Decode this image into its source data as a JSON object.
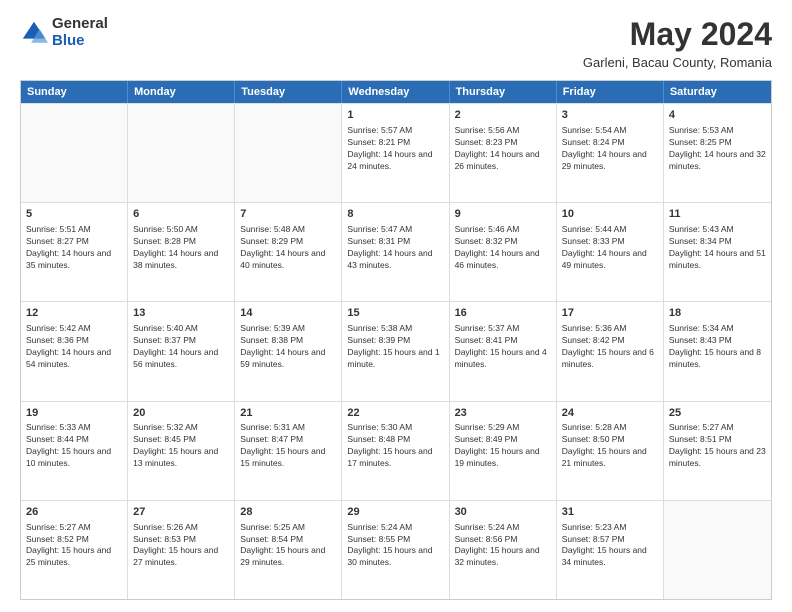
{
  "logo": {
    "general": "General",
    "blue": "Blue"
  },
  "title": "May 2024",
  "location": "Garleni, Bacau County, Romania",
  "header_days": [
    "Sunday",
    "Monday",
    "Tuesday",
    "Wednesday",
    "Thursday",
    "Friday",
    "Saturday"
  ],
  "weeks": [
    [
      {
        "day": "",
        "sunrise": "",
        "sunset": "",
        "daylight": ""
      },
      {
        "day": "",
        "sunrise": "",
        "sunset": "",
        "daylight": ""
      },
      {
        "day": "",
        "sunrise": "",
        "sunset": "",
        "daylight": ""
      },
      {
        "day": "1",
        "sunrise": "Sunrise: 5:57 AM",
        "sunset": "Sunset: 8:21 PM",
        "daylight": "Daylight: 14 hours and 24 minutes."
      },
      {
        "day": "2",
        "sunrise": "Sunrise: 5:56 AM",
        "sunset": "Sunset: 8:23 PM",
        "daylight": "Daylight: 14 hours and 26 minutes."
      },
      {
        "day": "3",
        "sunrise": "Sunrise: 5:54 AM",
        "sunset": "Sunset: 8:24 PM",
        "daylight": "Daylight: 14 hours and 29 minutes."
      },
      {
        "day": "4",
        "sunrise": "Sunrise: 5:53 AM",
        "sunset": "Sunset: 8:25 PM",
        "daylight": "Daylight: 14 hours and 32 minutes."
      }
    ],
    [
      {
        "day": "5",
        "sunrise": "Sunrise: 5:51 AM",
        "sunset": "Sunset: 8:27 PM",
        "daylight": "Daylight: 14 hours and 35 minutes."
      },
      {
        "day": "6",
        "sunrise": "Sunrise: 5:50 AM",
        "sunset": "Sunset: 8:28 PM",
        "daylight": "Daylight: 14 hours and 38 minutes."
      },
      {
        "day": "7",
        "sunrise": "Sunrise: 5:48 AM",
        "sunset": "Sunset: 8:29 PM",
        "daylight": "Daylight: 14 hours and 40 minutes."
      },
      {
        "day": "8",
        "sunrise": "Sunrise: 5:47 AM",
        "sunset": "Sunset: 8:31 PM",
        "daylight": "Daylight: 14 hours and 43 minutes."
      },
      {
        "day": "9",
        "sunrise": "Sunrise: 5:46 AM",
        "sunset": "Sunset: 8:32 PM",
        "daylight": "Daylight: 14 hours and 46 minutes."
      },
      {
        "day": "10",
        "sunrise": "Sunrise: 5:44 AM",
        "sunset": "Sunset: 8:33 PM",
        "daylight": "Daylight: 14 hours and 49 minutes."
      },
      {
        "day": "11",
        "sunrise": "Sunrise: 5:43 AM",
        "sunset": "Sunset: 8:34 PM",
        "daylight": "Daylight: 14 hours and 51 minutes."
      }
    ],
    [
      {
        "day": "12",
        "sunrise": "Sunrise: 5:42 AM",
        "sunset": "Sunset: 8:36 PM",
        "daylight": "Daylight: 14 hours and 54 minutes."
      },
      {
        "day": "13",
        "sunrise": "Sunrise: 5:40 AM",
        "sunset": "Sunset: 8:37 PM",
        "daylight": "Daylight: 14 hours and 56 minutes."
      },
      {
        "day": "14",
        "sunrise": "Sunrise: 5:39 AM",
        "sunset": "Sunset: 8:38 PM",
        "daylight": "Daylight: 14 hours and 59 minutes."
      },
      {
        "day": "15",
        "sunrise": "Sunrise: 5:38 AM",
        "sunset": "Sunset: 8:39 PM",
        "daylight": "Daylight: 15 hours and 1 minute."
      },
      {
        "day": "16",
        "sunrise": "Sunrise: 5:37 AM",
        "sunset": "Sunset: 8:41 PM",
        "daylight": "Daylight: 15 hours and 4 minutes."
      },
      {
        "day": "17",
        "sunrise": "Sunrise: 5:36 AM",
        "sunset": "Sunset: 8:42 PM",
        "daylight": "Daylight: 15 hours and 6 minutes."
      },
      {
        "day": "18",
        "sunrise": "Sunrise: 5:34 AM",
        "sunset": "Sunset: 8:43 PM",
        "daylight": "Daylight: 15 hours and 8 minutes."
      }
    ],
    [
      {
        "day": "19",
        "sunrise": "Sunrise: 5:33 AM",
        "sunset": "Sunset: 8:44 PM",
        "daylight": "Daylight: 15 hours and 10 minutes."
      },
      {
        "day": "20",
        "sunrise": "Sunrise: 5:32 AM",
        "sunset": "Sunset: 8:45 PM",
        "daylight": "Daylight: 15 hours and 13 minutes."
      },
      {
        "day": "21",
        "sunrise": "Sunrise: 5:31 AM",
        "sunset": "Sunset: 8:47 PM",
        "daylight": "Daylight: 15 hours and 15 minutes."
      },
      {
        "day": "22",
        "sunrise": "Sunrise: 5:30 AM",
        "sunset": "Sunset: 8:48 PM",
        "daylight": "Daylight: 15 hours and 17 minutes."
      },
      {
        "day": "23",
        "sunrise": "Sunrise: 5:29 AM",
        "sunset": "Sunset: 8:49 PM",
        "daylight": "Daylight: 15 hours and 19 minutes."
      },
      {
        "day": "24",
        "sunrise": "Sunrise: 5:28 AM",
        "sunset": "Sunset: 8:50 PM",
        "daylight": "Daylight: 15 hours and 21 minutes."
      },
      {
        "day": "25",
        "sunrise": "Sunrise: 5:27 AM",
        "sunset": "Sunset: 8:51 PM",
        "daylight": "Daylight: 15 hours and 23 minutes."
      }
    ],
    [
      {
        "day": "26",
        "sunrise": "Sunrise: 5:27 AM",
        "sunset": "Sunset: 8:52 PM",
        "daylight": "Daylight: 15 hours and 25 minutes."
      },
      {
        "day": "27",
        "sunrise": "Sunrise: 5:26 AM",
        "sunset": "Sunset: 8:53 PM",
        "daylight": "Daylight: 15 hours and 27 minutes."
      },
      {
        "day": "28",
        "sunrise": "Sunrise: 5:25 AM",
        "sunset": "Sunset: 8:54 PM",
        "daylight": "Daylight: 15 hours and 29 minutes."
      },
      {
        "day": "29",
        "sunrise": "Sunrise: 5:24 AM",
        "sunset": "Sunset: 8:55 PM",
        "daylight": "Daylight: 15 hours and 30 minutes."
      },
      {
        "day": "30",
        "sunrise": "Sunrise: 5:24 AM",
        "sunset": "Sunset: 8:56 PM",
        "daylight": "Daylight: 15 hours and 32 minutes."
      },
      {
        "day": "31",
        "sunrise": "Sunrise: 5:23 AM",
        "sunset": "Sunset: 8:57 PM",
        "daylight": "Daylight: 15 hours and 34 minutes."
      },
      {
        "day": "",
        "sunrise": "",
        "sunset": "",
        "daylight": ""
      }
    ]
  ]
}
